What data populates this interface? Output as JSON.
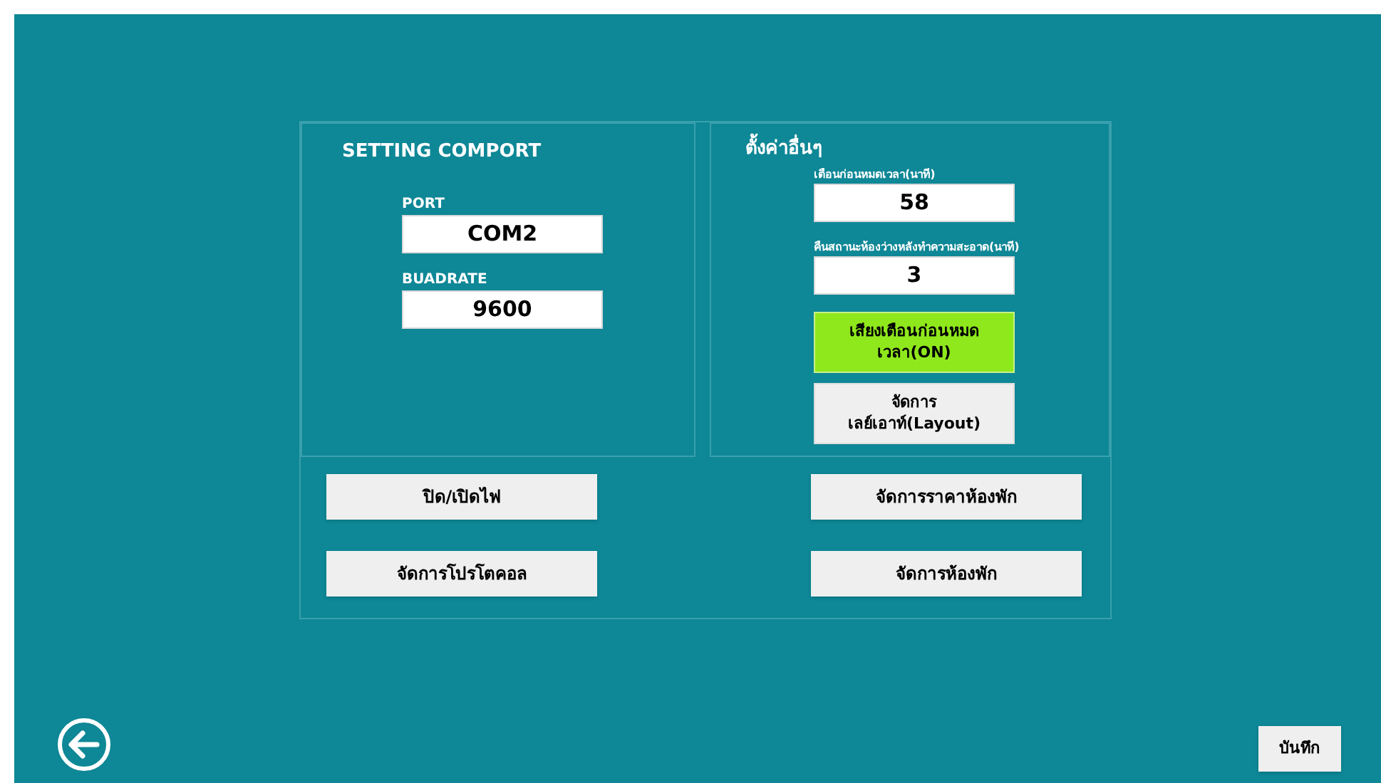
{
  "comport_panel": {
    "title": "SETTING COMPORT",
    "fields": [
      {
        "label": "PORT",
        "value": "COM2"
      },
      {
        "label": "BUADRATE",
        "value": "9600"
      }
    ]
  },
  "other_panel": {
    "title": "ตั้งค่าอื่นๆ",
    "fields": [
      {
        "label": "เตือนก่อนหมดเวลา(นาที)",
        "value": "58"
      },
      {
        "label": "คืนสถานะห้องว่างหลังทำความสะอาด(นาที)",
        "value": "3"
      }
    ],
    "buttons": [
      {
        "label": "เสียงเตือนก่อนหมดเวลา(ON)",
        "on": true
      },
      {
        "label": "จัดการเลย์เอาท์(Layout)",
        "on": false
      }
    ]
  },
  "action_buttons": [
    {
      "label": "ปิด/เปิดไฟ"
    },
    {
      "label": "จัดการราคาห้องพัก"
    },
    {
      "label": "จัดการโปรโตคอล"
    },
    {
      "label": "จัดการห้องพัก"
    }
  ],
  "save_button": {
    "label": "บันทึก"
  }
}
